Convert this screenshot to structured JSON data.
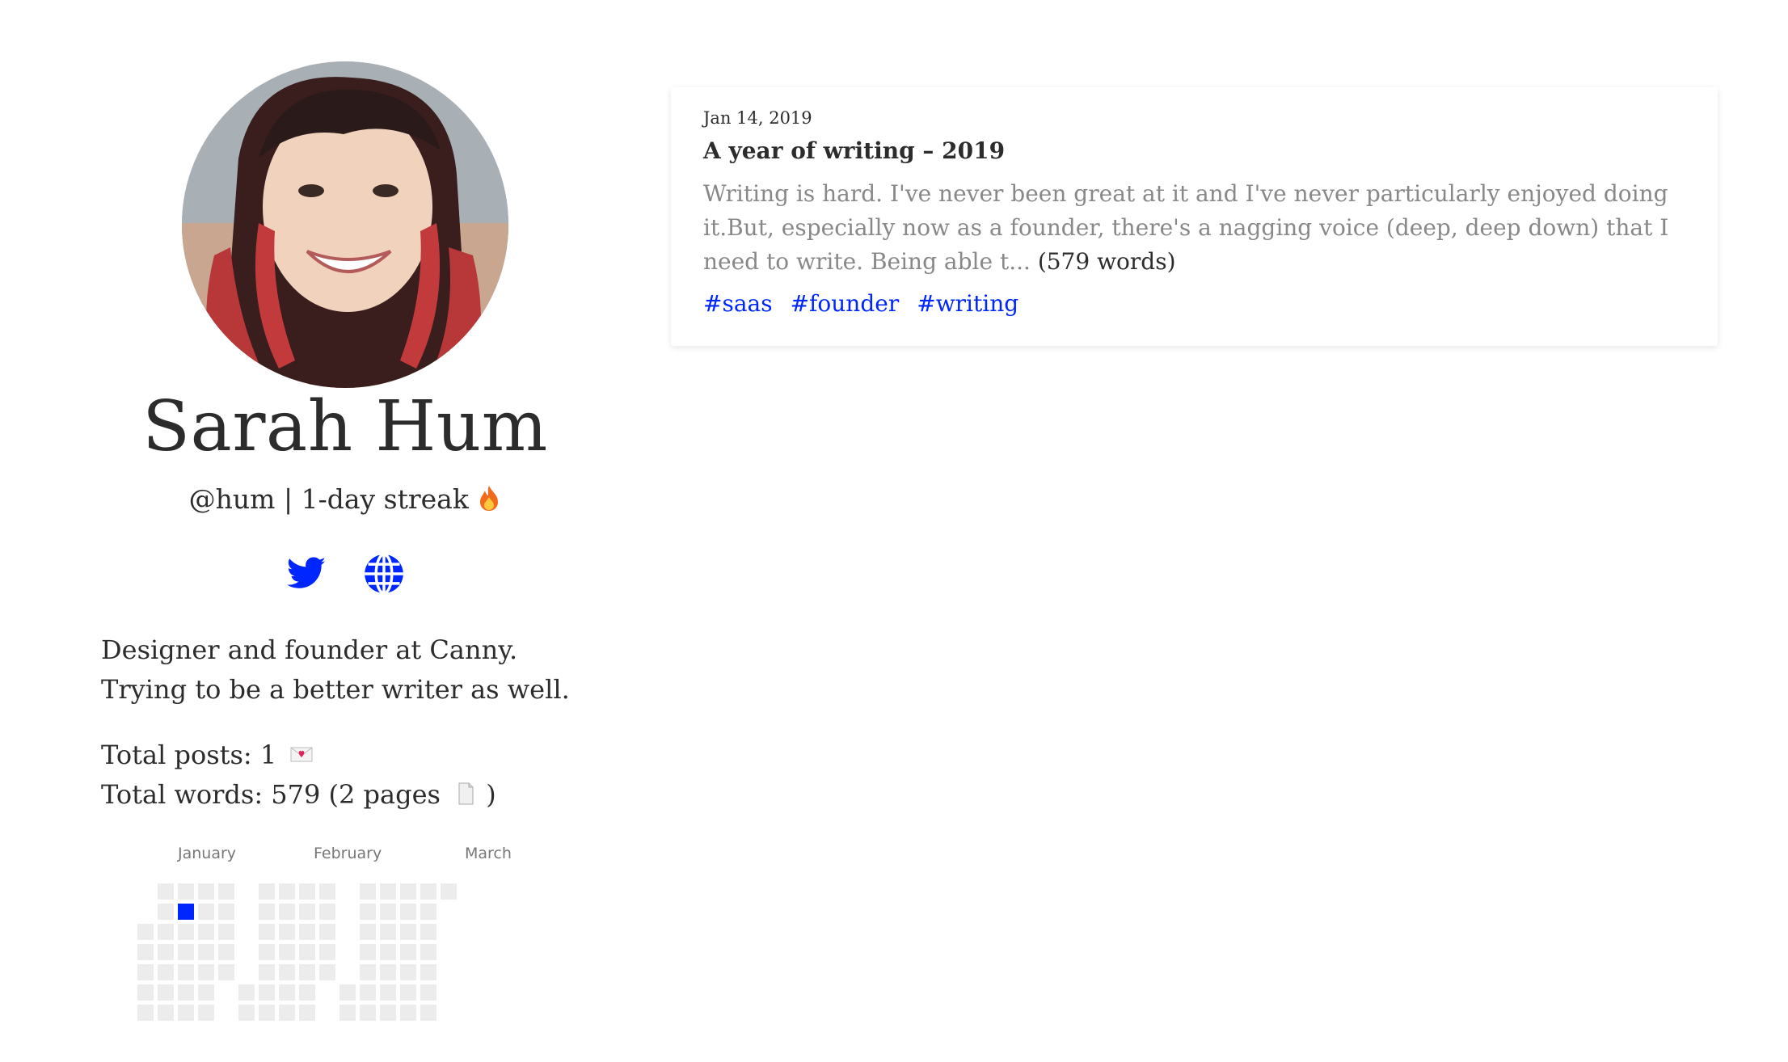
{
  "profile": {
    "name": "Sarah Hum",
    "handle_line": "@hum | 1-day streak",
    "bio": "Designer and founder at Canny. Trying to be a better writer as well.",
    "total_posts": "Total posts: 1",
    "total_words_prefix": "Total words: 579 (2 pages",
    "total_words_suffix": ")",
    "social": [
      "twitter-icon",
      "globe-icon"
    ],
    "accent_color": "#0026ff"
  },
  "calendar": {
    "months": [
      "January",
      "February",
      "March"
    ],
    "active_day": "Jan 14, 2019",
    "active_color": "#0026ff",
    "empty_color": "#ececec"
  },
  "post": {
    "date": "Jan 14, 2019",
    "title": "A year of writing – 2019",
    "excerpt": "Writing is hard. I've never been great at it and I've never particularly enjoyed doing it.But, especially now as a founder, there's a nagging voice (deep, deep down) that I need to write. Being able t...",
    "word_count": "(579 words)",
    "tags": [
      "#saas",
      "#founder",
      "#writing"
    ]
  }
}
